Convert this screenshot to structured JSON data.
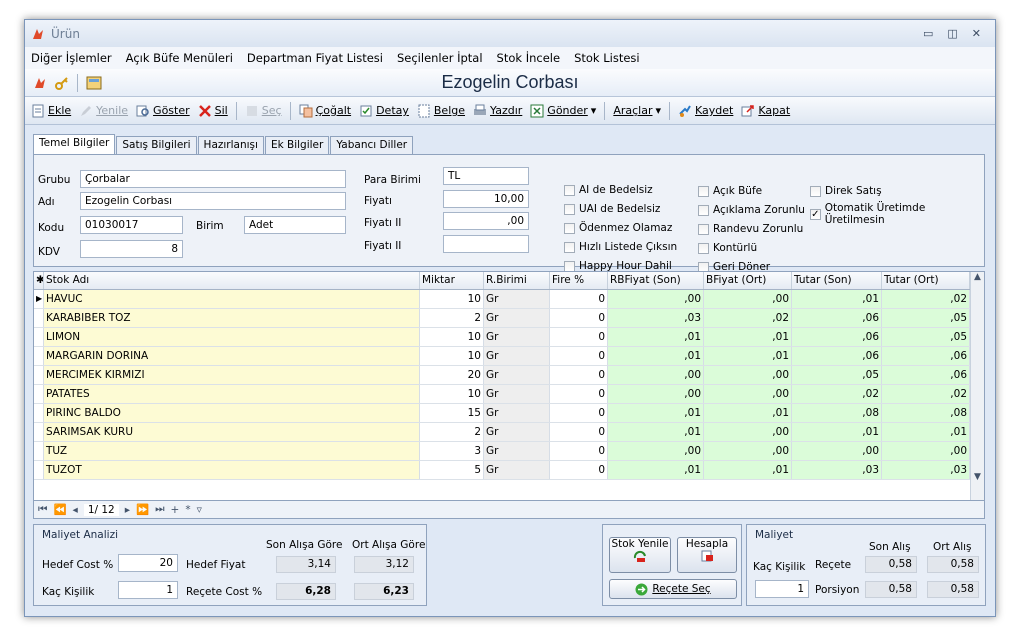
{
  "window": {
    "title": "Ürün"
  },
  "menu": [
    "Diğer İşlemler",
    "Açık Büfe Menüleri",
    "Departman Fiyat Listesi",
    "Seçilenler İptal",
    "Stok İncele",
    "Stok Listesi"
  ],
  "document_title": "Ezogelin Corbası",
  "toolbar": {
    "ekle": "Ekle",
    "yenile": "Yenile",
    "goster": "Göster",
    "sil": "Sil",
    "sec": "Seç",
    "cogalt": "Çoğalt",
    "detay": "Detay",
    "belge": "Belge",
    "yazdir": "Yazdır",
    "gonder": "Gönder",
    "araclar": "Araçlar",
    "kaydet": "Kaydet",
    "kapat": "Kapat"
  },
  "tabs": [
    "Temel Bilgiler",
    "Satış Bilgileri",
    "Hazırlanışı",
    "Ek Bilgiler",
    "Yabancı Diller"
  ],
  "form": {
    "grubu_label": "Grubu",
    "grubu": "Çorbalar",
    "adi_label": "Adı",
    "adi": "Ezogelin Corbası",
    "kodu_label": "Kodu",
    "kodu": "01030017",
    "birim_label": "Birim",
    "birim": "Adet",
    "kdv_label": "KDV",
    "kdv": "8",
    "para_birimi_label": "Para Birimi",
    "para_birimi": "TL",
    "fiyati_label": "Fiyatı",
    "fiyati": "10,00",
    "fiyati2_label": "Fiyatı II",
    "fiyati2": ",00",
    "fiyati3_label": "Fiyatı II",
    "fiyati3": ""
  },
  "checks": {
    "col1": [
      {
        "label": "AI de Bedelsiz",
        "checked": false
      },
      {
        "label": "UAI de Bedelsiz",
        "checked": false
      },
      {
        "label": "Ödenmez Olamaz",
        "checked": false
      },
      {
        "label": "Hızlı Listede Çıksın",
        "checked": false
      },
      {
        "label": "Happy Hour Dahil",
        "checked": false
      }
    ],
    "col2": [
      {
        "label": "Açık Büfe",
        "checked": false
      },
      {
        "label": "Açıklama Zorunlu",
        "checked": false
      },
      {
        "label": "Randevu Zorunlu",
        "checked": false
      },
      {
        "label": "Kontürlü",
        "checked": false
      },
      {
        "label": "Geri Döner",
        "checked": false
      }
    ],
    "col3": [
      {
        "label": "Direk Satış",
        "checked": false
      },
      {
        "label": "Otomatik Üretimde Üretilmesin",
        "checked": true
      }
    ]
  },
  "grid": {
    "columns": [
      "Stok Adı",
      "Miktar",
      "R.Birimi",
      "Fire %",
      "RBFiyat (Son)",
      "BFiyat (Ort)",
      "Tutar (Son)",
      "Tutar (Ort)"
    ],
    "rows": [
      [
        "HAVUC",
        "10",
        "Gr",
        "0",
        ",00",
        ",00",
        ",01",
        ",02"
      ],
      [
        "KARABIBER TOZ",
        "2",
        "Gr",
        "0",
        ",03",
        ",02",
        ",06",
        ",05"
      ],
      [
        "LIMON",
        "10",
        "Gr",
        "0",
        ",01",
        ",01",
        ",06",
        ",05"
      ],
      [
        "MARGARIN DORINA",
        "10",
        "Gr",
        "0",
        ",01",
        ",01",
        ",06",
        ",06"
      ],
      [
        "MERCIMEK KIRMIZI",
        "20",
        "Gr",
        "0",
        ",00",
        ",00",
        ",05",
        ",06"
      ],
      [
        "PATATES",
        "10",
        "Gr",
        "0",
        ",00",
        ",00",
        ",02",
        ",02"
      ],
      [
        "PIRINC BALDO",
        "15",
        "Gr",
        "0",
        ",01",
        ",01",
        ",08",
        ",08"
      ],
      [
        "SARIMSAK KURU",
        "2",
        "Gr",
        "0",
        ",01",
        ",00",
        ",01",
        ",01"
      ],
      [
        "TUZ",
        "3",
        "Gr",
        "0",
        ",00",
        ",00",
        ",00",
        ",00"
      ],
      [
        "TUZOT",
        "5",
        "Gr",
        "0",
        ",01",
        ",01",
        ",03",
        ",03"
      ]
    ],
    "nav_position": "1/ 12"
  },
  "maliyet_analizi": {
    "title": "Maliyet Analizi",
    "hedef_cost_label": "Hedef Cost %",
    "hedef_cost": "20",
    "kac_kisilik_label": "Kaç Kişilik",
    "kac_kisilik": "1",
    "hedef_fiyat_label": "Hedef Fiyat",
    "recete_cost_label": "Reçete Cost %",
    "son_alis_header": "Son Alışa Göre",
    "ort_alis_header": "Ort Alışa Göre",
    "hedef_fiyat_son": "3,14",
    "hedef_fiyat_ort": "3,12",
    "recete_cost_son": "6,28",
    "recete_cost_ort": "6,23"
  },
  "actions": {
    "stok_yenile": "Stok Yenile",
    "hesapla": "Hesapla",
    "recete_sec": "Reçete Seç"
  },
  "maliyet": {
    "title": "Maliyet",
    "son_alis": "Son Alış",
    "ort_alis": "Ort Alış",
    "kac_kisilik_label": "Kaç Kişilik",
    "kac_kisilik": "1",
    "recete_label": "Reçete",
    "porsiyon_label": "Porsiyon",
    "recete_son": "0,58",
    "recete_ort": "0,58",
    "porsiyon_son": "0,58",
    "porsiyon_ort": "0,58"
  }
}
